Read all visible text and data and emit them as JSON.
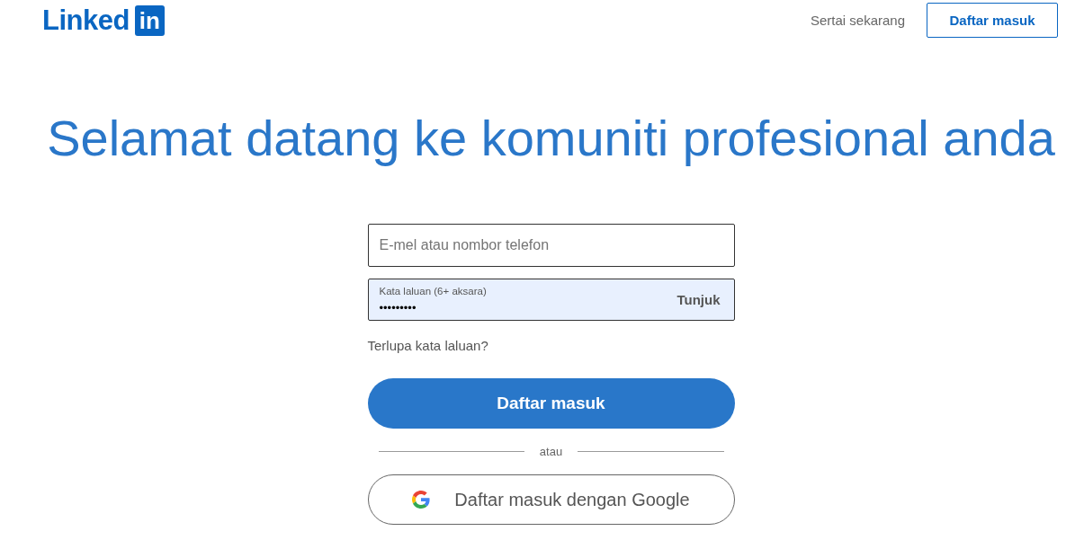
{
  "header": {
    "logo": {
      "wordmark": "Linked",
      "badge": "in"
    },
    "join_link": "Sertai sekarang",
    "sign_in_button": "Daftar masuk"
  },
  "headline": "Selamat datang ke komuniti profesional anda",
  "form": {
    "email_field": {
      "placeholder": "E-mel atau nombor telefon"
    },
    "password_field": {
      "label": "Kata laluan (6+ aksara)",
      "value": "•••••••••",
      "autofilled": true,
      "show_button": "Tunjuk"
    },
    "forgot_link": "Terlupa kata laluan?",
    "submit_button": "Daftar masuk",
    "divider": "atau",
    "google_button": "Daftar masuk dengan Google"
  }
}
